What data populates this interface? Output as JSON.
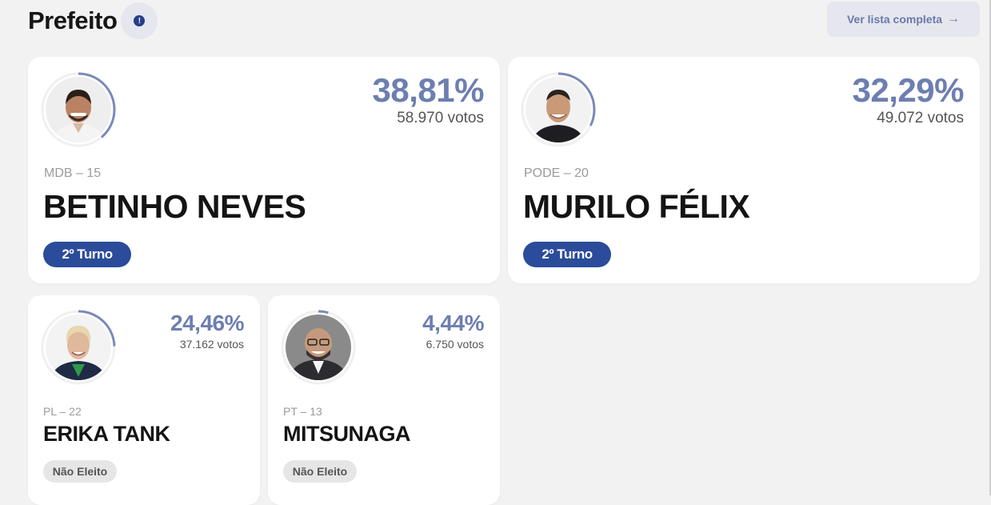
{
  "section": {
    "title": "Prefeito",
    "info_icon_glyph": "!",
    "list_button_label": "Ver lista completa",
    "list_button_arrow": "→"
  },
  "colors": {
    "background": "#f2f2f2",
    "accent": "#2a4c9a",
    "percent": "#6d7eb0",
    "progress_ring": "#7a8ab8"
  },
  "candidates": [
    {
      "percent": "38,81%",
      "percent_value": 0.3881,
      "votes": "58.970 votos",
      "party": "MDB – 15",
      "name": "BETINHO NEVES",
      "status": "2º Turno",
      "status_type": "turno",
      "photo_icon": "candidate-photo"
    },
    {
      "percent": "32,29%",
      "percent_value": 0.3229,
      "votes": "49.072 votos",
      "party": "PODE – 20",
      "name": "MURILO FÉLIX",
      "status": "2º Turno",
      "status_type": "turno",
      "photo_icon": "candidate-photo"
    },
    {
      "percent": "24,46%",
      "percent_value": 0.2446,
      "votes": "37.162 votos",
      "party": "PL – 22",
      "name": "ERIKA TANK",
      "status": "Não Eleito",
      "status_type": "nao-eleito",
      "photo_icon": "candidate-photo"
    },
    {
      "percent": "4,44%",
      "percent_value": 0.0444,
      "votes": "6.750 votos",
      "party": "PT – 13",
      "name": "MITSUNAGA",
      "status": "Não Eleito",
      "status_type": "nao-eleito",
      "photo_icon": "candidate-photo"
    }
  ]
}
